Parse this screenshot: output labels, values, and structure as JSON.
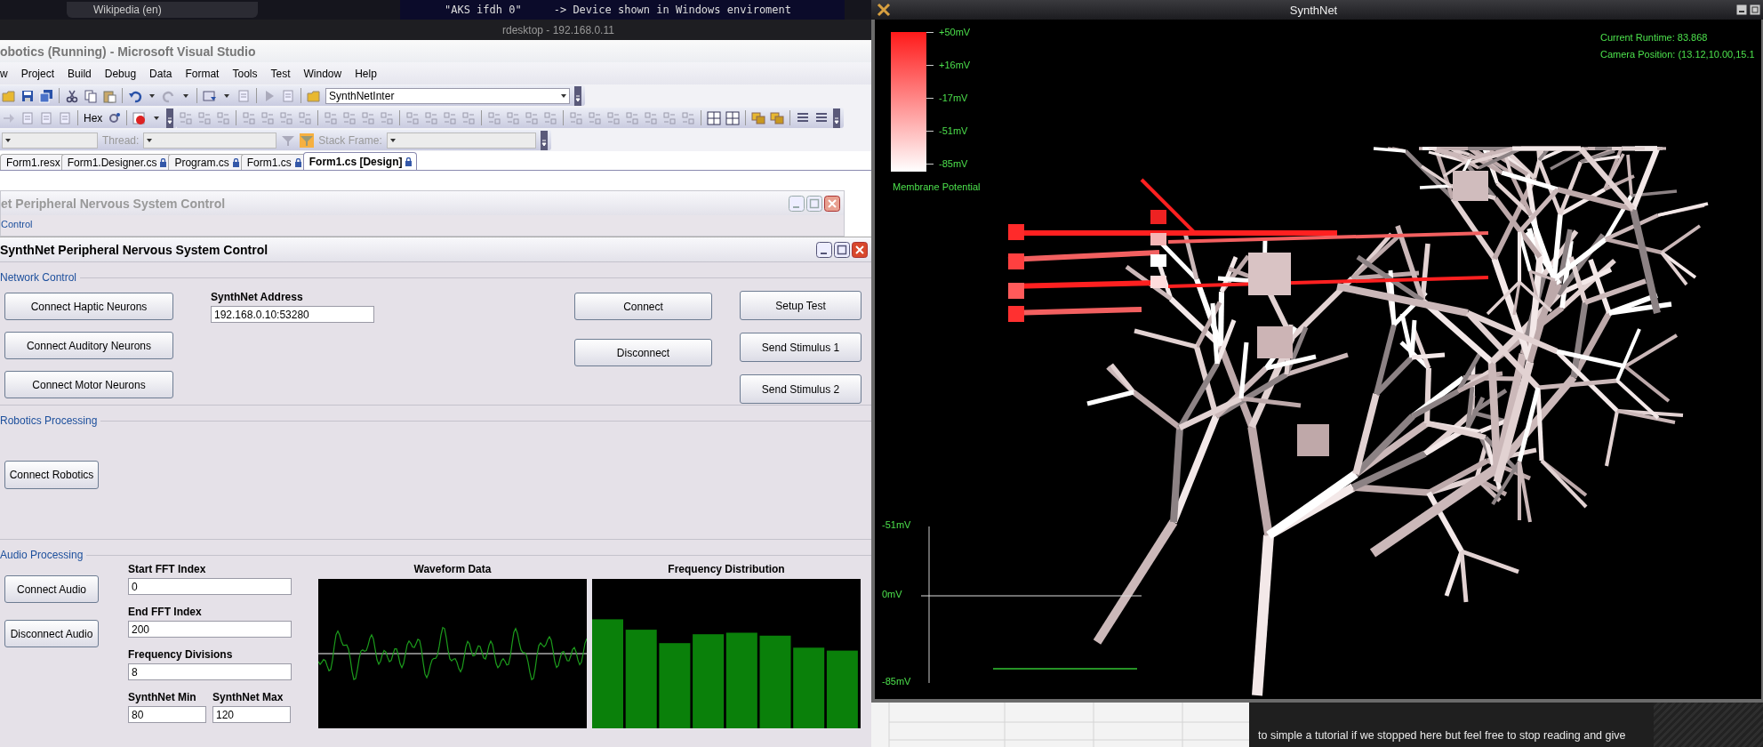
{
  "desktop": {
    "browser_tab": "Wikipedia (en)",
    "terminal_text": "\"AKS ifdh 0\"",
    "terminal_comment": "-> Device shown in Windows enviroment"
  },
  "rdesktop": {
    "title": "rdesktop - 192.168.0.11"
  },
  "visual_studio": {
    "title": "obotics (Running) - Microsoft Visual Studio",
    "menu": [
      "w",
      "Project",
      "Build",
      "Debug",
      "Data",
      "Format",
      "Tools",
      "Test",
      "Window",
      "Help"
    ],
    "toolbar": {
      "configuration": "SynthNetInter",
      "hex_label": "Hex",
      "thread_label": "Thread:",
      "stack_frame_label": "Stack Frame:"
    },
    "tabs": [
      {
        "label": "Form1.resx",
        "locked": false,
        "selected": false
      },
      {
        "label": "Form1.Designer.cs",
        "locked": true,
        "selected": false
      },
      {
        "label": "Program.cs",
        "locked": true,
        "selected": false
      },
      {
        "label": "Form1.cs",
        "locked": true,
        "selected": false
      },
      {
        "label": "Form1.cs [Design]",
        "locked": true,
        "selected": true
      }
    ],
    "designer": {
      "back_form": {
        "title": "et Peripheral Nervous System Control",
        "group": "Control"
      },
      "form": {
        "title": "SynthNet Peripheral Nervous System Control",
        "network_control": {
          "legend": "Network Control",
          "neuron_buttons": [
            "Connect Haptic Neurons",
            "Connect Auditory Neurons",
            "Connect Motor Neurons"
          ],
          "address_label": "SynthNet Address",
          "address_value": "192.168.0.10:53280",
          "connection_buttons": [
            "Connect",
            "Disconnect"
          ],
          "test_buttons": [
            "Setup Test",
            "Send Stimulus 1",
            "Send Stimulus 2"
          ]
        },
        "robotics_processing": {
          "legend": "Robotics Processing",
          "buttons": [
            "Connect Robotics"
          ]
        },
        "audio_processing": {
          "legend": "Audio Processing",
          "buttons": [
            "Connect Audio",
            "Disconnect Audio"
          ],
          "fields": [
            {
              "label": "Start FFT Index",
              "value": "0"
            },
            {
              "label": "End FFT Index",
              "value": "200"
            },
            {
              "label": "Frequency Divisions",
              "value": "8"
            }
          ],
          "range_fields": [
            {
              "label": "SynthNet Min",
              "value": "80"
            },
            {
              "label": "SynthNet Max",
              "value": "120"
            }
          ],
          "waveform_title": "Waveform Data",
          "frequency_title": "Frequency Distribution"
        }
      }
    }
  },
  "synthnet": {
    "title": "SynthNet",
    "legend": {
      "ticks": [
        "+50mV",
        "+16mV",
        "-17mV",
        "-51mV",
        "-85mV"
      ],
      "caption": "Membrane Potential"
    },
    "runtime": "Current Runtime: 83.868",
    "camera_position": "Camera Position: (13.12,10.00,15.1",
    "trace_scale": [
      "-51mV",
      "0mV",
      "-85mV"
    ]
  },
  "tutorial_text": "to simple a tutorial if we stopped here but feel free to stop reading and give"
}
